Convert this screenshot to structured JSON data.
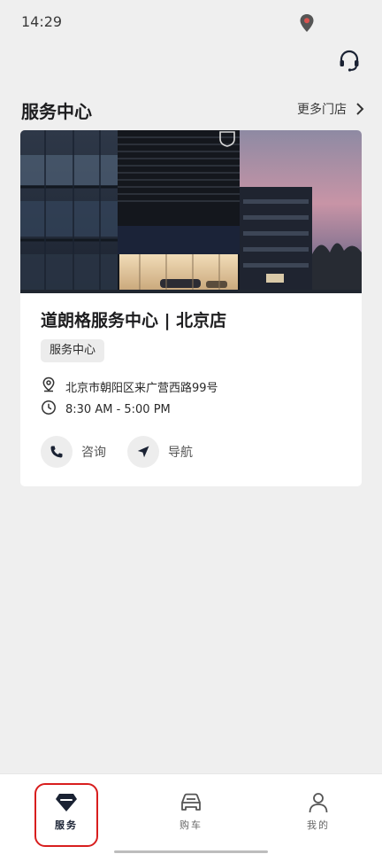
{
  "status_bar": {
    "time": "14:29",
    "location_icon": "location-pin-icon"
  },
  "header": {
    "support_icon": "headset-icon"
  },
  "section": {
    "title": "服务中心",
    "more_label": "更多门店",
    "more_icon": "chevron-right-icon"
  },
  "store": {
    "name": "道朗格服务中心 | 北京店",
    "tag": "服务中心",
    "address": "北京市朝阳区来广营西路99号",
    "hours": "8:30 AM - 5:00 PM",
    "actions": [
      {
        "label": "咨询",
        "icon": "phone-icon"
      },
      {
        "label": "导航",
        "icon": "navigate-icon"
      }
    ]
  },
  "tabbar": {
    "items": [
      {
        "label": "服务",
        "icon": "service-diamond-icon",
        "active": true
      },
      {
        "label": "购车",
        "icon": "car-icon",
        "active": false
      },
      {
        "label": "我的",
        "icon": "person-icon",
        "active": false
      }
    ]
  },
  "colors": {
    "accent": "#1a2233",
    "highlight": "#d81e1e",
    "background": "#efefef"
  }
}
